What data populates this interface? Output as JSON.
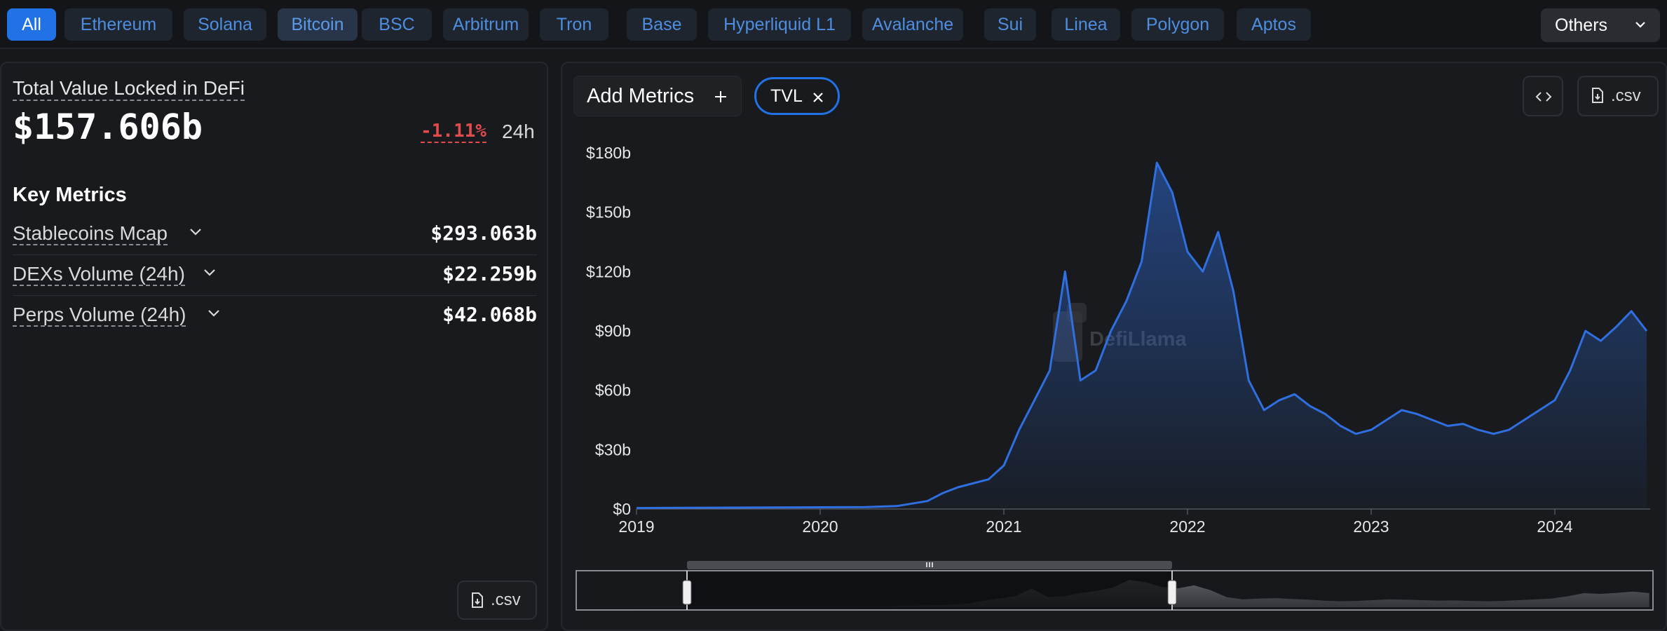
{
  "chains": [
    {
      "label": "All",
      "state": "active"
    },
    {
      "label": "Ethereum",
      "state": "normal"
    },
    {
      "label": "Solana",
      "state": "normal"
    },
    {
      "label": "Bitcoin",
      "state": "dim"
    },
    {
      "label": "BSC",
      "state": "normal"
    },
    {
      "label": "Arbitrum",
      "state": "normal"
    },
    {
      "label": "Tron",
      "state": "normal"
    },
    {
      "label": "Base",
      "state": "normal"
    },
    {
      "label": "Hyperliquid L1",
      "state": "normal"
    },
    {
      "label": "Avalanche",
      "state": "normal"
    },
    {
      "label": "Sui",
      "state": "normal"
    },
    {
      "label": "Linea",
      "state": "normal"
    },
    {
      "label": "Polygon",
      "state": "normal"
    },
    {
      "label": "Aptos",
      "state": "normal"
    }
  ],
  "others_label": "Others",
  "summary": {
    "title": "Total Value Locked in DeFi",
    "value": "$157.606b",
    "change": "-1.11%",
    "period": "24h"
  },
  "key_metrics": {
    "heading": "Key Metrics",
    "items": [
      {
        "label": "Stablecoins Mcap",
        "value": "$293.063b"
      },
      {
        "label": "DEXs Volume (24h)",
        "value": "$22.259b"
      },
      {
        "label": "Perps Volume (24h)",
        "value": "$42.068b"
      }
    ]
  },
  "left_csv_label": ".csv",
  "toolbar": {
    "add_metrics_label": "Add Metrics",
    "active_metric": "TVL",
    "csv_label": ".csv"
  },
  "watermark": "DefiLlama",
  "colors": {
    "accent": "#2172e5",
    "line": "#2f6fe0",
    "negative": "#e14b4b"
  },
  "icons": [
    "plus-icon",
    "close-icon",
    "code-icon",
    "download-file-icon",
    "chevron-down-icon",
    "llama-logo-icon"
  ],
  "chart_data": {
    "type": "area",
    "series": [
      {
        "x": [
          "2019-01",
          "2019-04",
          "2019-07",
          "2019-10",
          "2020-01",
          "2020-04",
          "2020-06",
          "2020-08",
          "2020-09",
          "2020-10",
          "2020-11",
          "2020-12",
          "2021-01",
          "2021-02",
          "2021-03",
          "2021-04",
          "2021-05",
          "2021-06",
          "2021-07",
          "2021-08",
          "2021-09",
          "2021-10",
          "2021-11",
          "2021-12",
          "2022-01",
          "2022-02",
          "2022-03",
          "2022-04",
          "2022-05",
          "2022-06",
          "2022-07",
          "2022-08",
          "2022-09",
          "2022-10",
          "2022-11",
          "2022-12",
          "2023-01",
          "2023-02",
          "2023-03",
          "2023-04",
          "2023-05",
          "2023-06",
          "2023-07",
          "2023-08",
          "2023-09",
          "2023-10",
          "2023-11",
          "2023-12",
          "2024-01",
          "2024-02",
          "2024-03",
          "2024-04",
          "2024-05",
          "2024-06",
          "2024-07"
        ],
        "values": [
          0.5,
          0.6,
          0.7,
          0.8,
          0.9,
          1.0,
          1.5,
          4,
          8,
          11,
          13,
          15,
          22,
          40,
          55,
          70,
          120,
          65,
          70,
          90,
          105,
          125,
          175,
          160,
          130,
          120,
          140,
          110,
          65,
          50,
          55,
          58,
          52,
          48,
          42,
          38,
          40,
          45,
          50,
          48,
          45,
          42,
          43,
          40,
          38,
          40,
          45,
          50,
          55,
          70,
          90,
          85,
          92,
          100,
          90
        ]
      }
    ],
    "xticks": [
      "2019",
      "2020",
      "2021",
      "2022",
      "2023",
      "2024"
    ],
    "yticks": [
      "$0",
      "$30b",
      "$60b",
      "$90b",
      "$120b",
      "$150b",
      "$180b"
    ],
    "ylim": [
      0,
      180
    ],
    "grid": false
  }
}
